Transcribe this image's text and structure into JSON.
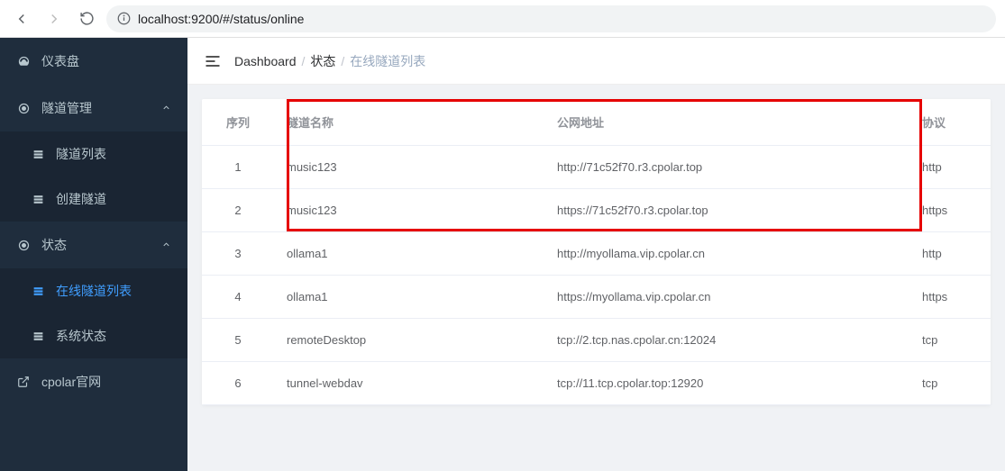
{
  "browser": {
    "url": "localhost:9200/#/status/online"
  },
  "sidebar": {
    "items": [
      {
        "label": "仪表盘",
        "icon": "dashboard"
      },
      {
        "label": "隧道管理",
        "icon": "gear",
        "expandable": true
      },
      {
        "label": "隧道列表",
        "icon": "table",
        "sub": true
      },
      {
        "label": "创建隧道",
        "icon": "table",
        "sub": true
      },
      {
        "label": "状态",
        "icon": "gear",
        "expandable": true
      },
      {
        "label": "在线隧道列表",
        "icon": "table",
        "sub": true,
        "active": true
      },
      {
        "label": "系统状态",
        "icon": "table",
        "sub": true
      },
      {
        "label": "cpolar官网",
        "icon": "external"
      }
    ]
  },
  "breadcrumb": {
    "items": [
      "Dashboard",
      "状态",
      "在线隧道列表"
    ]
  },
  "table": {
    "headers": {
      "index": "序列",
      "name": "隧道名称",
      "url": "公网地址",
      "proto": "协议"
    },
    "rows": [
      {
        "index": "1",
        "name": "music123",
        "url": "http://71c52f70.r3.cpolar.top",
        "proto": "http"
      },
      {
        "index": "2",
        "name": "music123",
        "url": "https://71c52f70.r3.cpolar.top",
        "proto": "https"
      },
      {
        "index": "3",
        "name": "ollama1",
        "url": "http://myollama.vip.cpolar.cn",
        "proto": "http"
      },
      {
        "index": "4",
        "name": "ollama1",
        "url": "https://myollama.vip.cpolar.cn",
        "proto": "https"
      },
      {
        "index": "5",
        "name": "remoteDesktop",
        "url": "tcp://2.tcp.nas.cpolar.cn:12024",
        "proto": "tcp"
      },
      {
        "index": "6",
        "name": "tunnel-webdav",
        "url": "tcp://11.tcp.cpolar.top:12920",
        "proto": "tcp"
      }
    ]
  }
}
